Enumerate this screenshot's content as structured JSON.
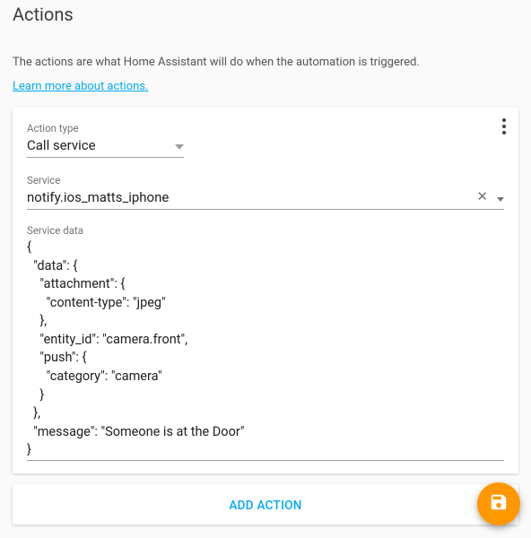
{
  "title": "Actions",
  "description": "The actions are what Home Assistant will do when the automation is triggered.",
  "learn_link": "Learn more about actions.",
  "action": {
    "type_label": "Action type",
    "type_value": "Call service",
    "service_label": "Service",
    "service_value": "notify.ios_matts_iphone",
    "data_label": "Service data",
    "data_value": "{\n  \"data\": {\n    \"attachment\": {\n      \"content-type\": \"jpeg\"\n    },\n    \"entity_id\": \"camera.front\",\n    \"push\": {\n      \"category\": \"camera\"\n    }\n  },\n  \"message\": \"Someone is at the Door\"\n}"
  },
  "add_action_label": "ADD ACTION"
}
